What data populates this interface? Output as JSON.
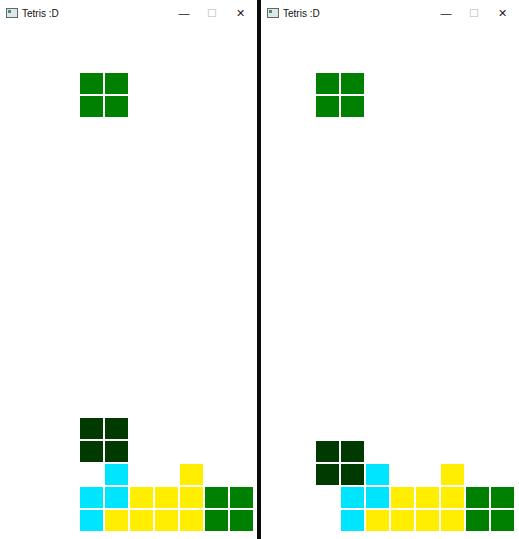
{
  "windows": [
    {
      "title": "Tetris :D",
      "controls": [
        {
          "glyph": "—",
          "disabled": false
        },
        {
          "glyph": "☐",
          "disabled": true
        },
        {
          "glyph": "✕",
          "disabled": false
        }
      ],
      "board": {
        "rows": [
          "..........",
          "..........",
          "...GG.....",
          "...GG.....",
          "..........",
          "..........",
          "..........",
          "..........",
          "..........",
          "..........",
          "..........",
          "..........",
          "..........",
          "..........",
          "..........",
          "..........",
          "..........",
          "...gg.....",
          "...gg.....",
          "....C..Y..",
          "...CCYYYGG",
          "...CYYYYGG"
        ]
      }
    },
    {
      "title": "Tetris :D",
      "controls": [
        {
          "glyph": "—",
          "disabled": false
        },
        {
          "glyph": "☐",
          "disabled": true
        },
        {
          "glyph": "✕",
          "disabled": false
        }
      ],
      "board": {
        "rows": [
          "..........",
          "..........",
          "..GG......",
          "..GG......",
          "..........",
          "..........",
          "..........",
          "..........",
          "..........",
          "..........",
          "..........",
          "..........",
          "..........",
          "..........",
          "..........",
          "..........",
          "..........",
          "..........",
          "..gg......",
          "..ggC..Y..",
          "...CCYYYGG",
          "...CYYYYGG"
        ]
      }
    }
  ],
  "legend": {
    ".": "#ffffff",
    "G": "#008000",
    "g": "#003a00",
    "C": "#00e5ff",
    "Y": "#ffee00"
  }
}
